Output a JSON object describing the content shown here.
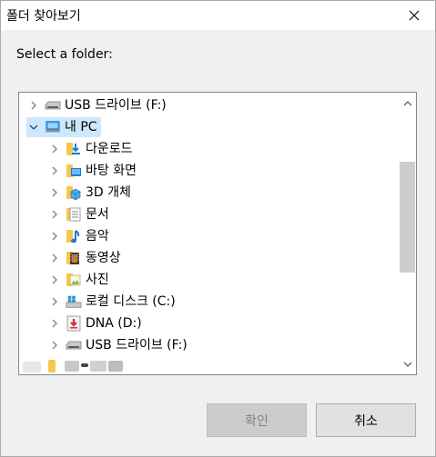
{
  "window": {
    "title": "폴더 찾아보기"
  },
  "prompt": "Select a folder:",
  "tree": {
    "items": [
      {
        "label": "USB 드라이브 (F:)",
        "icon": "usb-drive-icon",
        "expanded": false
      },
      {
        "label": "내 PC",
        "icon": "this-pc-icon",
        "expanded": true,
        "selected": true
      },
      {
        "label": "다운로드",
        "icon": "downloads-folder-icon",
        "expanded": false
      },
      {
        "label": "바탕 화면",
        "icon": "desktop-folder-icon",
        "expanded": false
      },
      {
        "label": "3D 개체",
        "icon": "3d-objects-folder-icon",
        "expanded": false
      },
      {
        "label": "문서",
        "icon": "documents-folder-icon",
        "expanded": false
      },
      {
        "label": "음악",
        "icon": "music-folder-icon",
        "expanded": false
      },
      {
        "label": "동영상",
        "icon": "videos-folder-icon",
        "expanded": false
      },
      {
        "label": "사진",
        "icon": "pictures-folder-icon",
        "expanded": false
      },
      {
        "label": "로컬 디스크 (C:)",
        "icon": "windows-drive-icon",
        "expanded": false
      },
      {
        "label": "DNA (D:)",
        "icon": "dna-drive-icon",
        "expanded": false
      },
      {
        "label": "USB 드라이브 (F:)",
        "icon": "usb-drive-icon",
        "expanded": false
      }
    ]
  },
  "buttons": {
    "ok_label": "확인",
    "cancel_label": "취소",
    "ok_enabled": false
  },
  "colors": {
    "selection": "#cce8ff",
    "window_bg": "#f0f0f0",
    "scroll_thumb": "#cdcdcd",
    "disabled_button": "#cccccc"
  }
}
